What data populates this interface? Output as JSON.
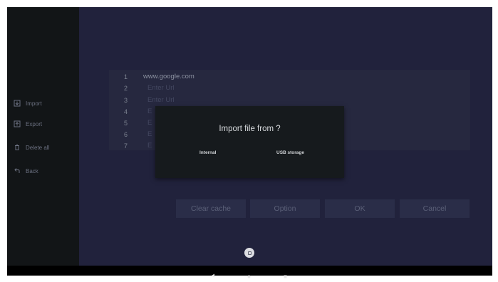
{
  "sidebar": {
    "items": [
      {
        "label": "Import",
        "icon": "import-icon"
      },
      {
        "label": "Export",
        "icon": "export-icon"
      },
      {
        "label": "Delete all",
        "icon": "trash-icon"
      },
      {
        "label": "Back",
        "icon": "back-icon"
      }
    ]
  },
  "url_list": [
    {
      "num": "1",
      "text": "www.google.com"
    },
    {
      "num": "2",
      "text": "Enter Url"
    },
    {
      "num": "3",
      "text": "Enter Url"
    },
    {
      "num": "4",
      "text": "E"
    },
    {
      "num": "5",
      "text": "E"
    },
    {
      "num": "6",
      "text": "E"
    },
    {
      "num": "7",
      "text": "E"
    }
  ],
  "buttons": {
    "clear_cache": "Clear cache",
    "option": "Option",
    "ok": "OK",
    "cancel": "Cancel"
  },
  "dialog": {
    "title": "Import file from ?",
    "internal": "Internal",
    "usb": "USB storage"
  },
  "nav": {
    "back_icon": "nav-back-icon",
    "home_icon": "nav-home-icon",
    "recents_icon": "nav-recents-icon"
  },
  "colors": {
    "background": "#21223c",
    "sidebar": "#121517",
    "dialog": "#161a1d"
  }
}
